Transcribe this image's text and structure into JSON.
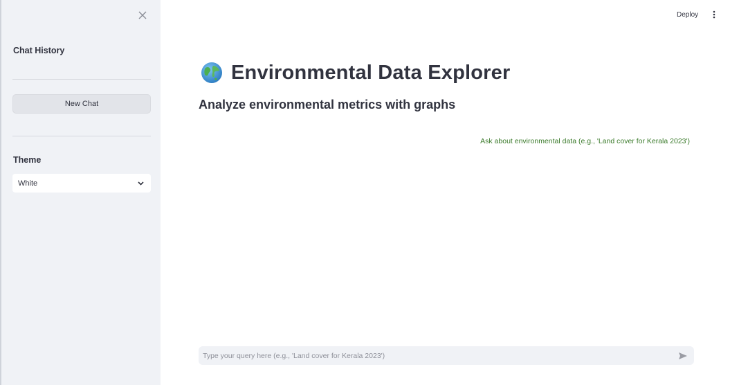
{
  "top_bar": {
    "deploy_label": "Deploy",
    "menu_icon": "kebab-menu-icon"
  },
  "sidebar": {
    "close_icon": "close-icon",
    "chat_history_heading": "Chat History",
    "new_chat_label": "New Chat",
    "theme_label": "Theme",
    "theme_selected": "White"
  },
  "main": {
    "title_icon": "globe-icon",
    "title": "Environmental Data Explorer",
    "subtitle": "Analyze environmental metrics with graphs",
    "hint": "Ask about environmental data (e.g., 'Land cover for Kerala 2023')"
  },
  "chat_input": {
    "placeholder": "Type your query here (e.g., 'Land cover for Kerala 2023')",
    "value": "",
    "send_icon": "send-icon"
  },
  "colors": {
    "sidebar_bg": "#f0f2f6",
    "text": "#31333f",
    "hint_green": "#3a7a2a"
  }
}
